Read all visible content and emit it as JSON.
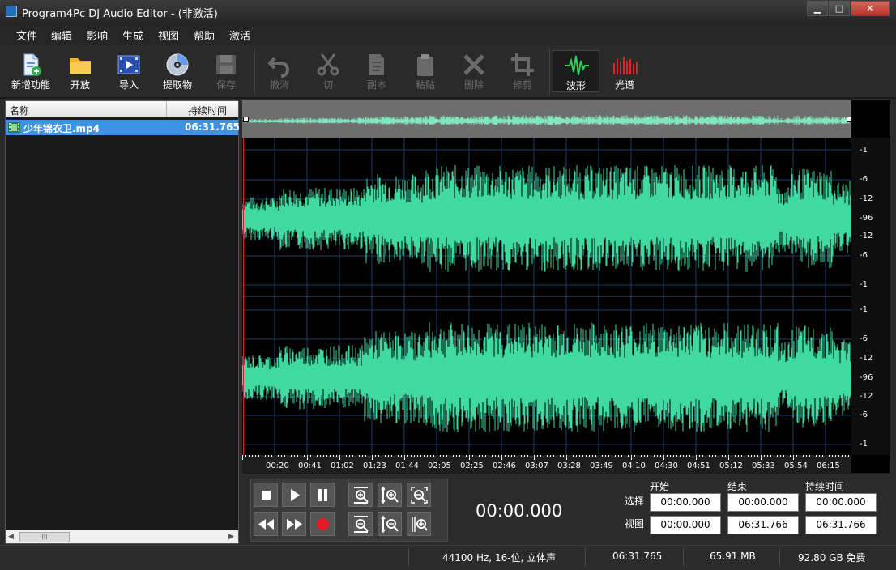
{
  "window": {
    "title": "Program4Pc DJ Audio Editor - (非激活)",
    "controls": {
      "minimize": "▁",
      "maximize": "□",
      "close": "✕"
    }
  },
  "menu": [
    "文件",
    "编辑",
    "影响",
    "生成",
    "视图",
    "帮助",
    "激活"
  ],
  "toolbar": {
    "new": "新增功能",
    "open": "开放",
    "import": "导入",
    "extract": "提取物",
    "save": "保存",
    "undo": "撤消",
    "cut": "切",
    "copy": "副本",
    "paste": "粘贴",
    "delete": "删除",
    "trim": "修剪",
    "waveform": "波形",
    "spectrum": "光谱"
  },
  "file_list": {
    "columns": {
      "name": "名称",
      "duration": "持续时间"
    },
    "rows": [
      {
        "name": "少年锦衣卫.mp4",
        "duration": "06:31.765"
      }
    ],
    "scroll_thumb": "III"
  },
  "ruler_labels": [
    "-1",
    "-6",
    "-12",
    "-96",
    "-12",
    "-6",
    "-1"
  ],
  "timeline_ticks": [
    "00:20",
    "00:41",
    "01:02",
    "01:23",
    "01:44",
    "02:05",
    "02:25",
    "02:46",
    "03:07",
    "03:28",
    "03:49",
    "04:10",
    "04:30",
    "04:51",
    "05:12",
    "05:33",
    "05:54",
    "06:15"
  ],
  "transport": {
    "current_time": "00:00.000"
  },
  "time_fields": {
    "headers": {
      "start": "开始",
      "end": "结束",
      "duration": "持续时间"
    },
    "selection": {
      "label": "选择",
      "start": "00:00.000",
      "end": "00:00.000",
      "duration": "00:00.000"
    },
    "view": {
      "label": "视图",
      "start": "00:00.000",
      "end": "06:31.766",
      "duration": "06:31.766"
    }
  },
  "status": {
    "format": "44100 Hz, 16-位, 立体声",
    "length": "06:31.765",
    "file_size": "65.91 MB",
    "disk_free": "92.80 GB 免费"
  },
  "colors": {
    "waveform": "#40d9a0",
    "selected_row": "#3f93e6",
    "record": "#e01b2a",
    "grid": "#1e3c6e"
  }
}
